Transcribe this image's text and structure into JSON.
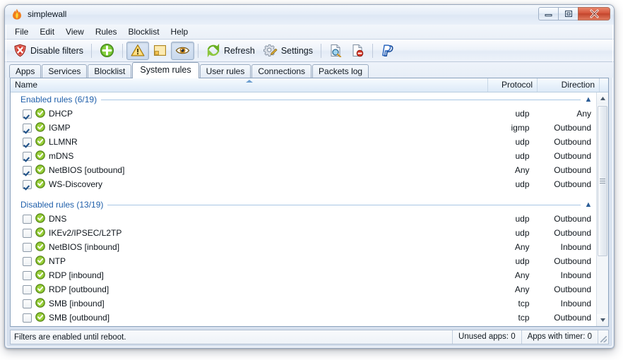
{
  "window": {
    "title": "simplewall",
    "icon": "flame-icon",
    "buttons": {
      "minimize": "Minimize",
      "maximize": "Maximize",
      "close": "Close"
    }
  },
  "menubar": {
    "items": [
      "File",
      "Edit",
      "View",
      "Rules",
      "Blocklist",
      "Help"
    ]
  },
  "toolbar": {
    "disable_filters_label": "Disable filters",
    "refresh_label": "Refresh",
    "settings_label": "Settings",
    "icons": [
      "shield-cross-icon",
      "add-circle-icon",
      "warning-triangle-icon",
      "notification-window-icon",
      "eye-icon",
      "refresh-icon",
      "settings-gear-icon",
      "log-search-icon",
      "log-clear-icon",
      "paypal-icon"
    ]
  },
  "tabs": {
    "items": [
      {
        "label": "Apps",
        "active": false
      },
      {
        "label": "Services",
        "active": false
      },
      {
        "label": "Blocklist",
        "active": false
      },
      {
        "label": "System rules",
        "active": true
      },
      {
        "label": "User rules",
        "active": false
      },
      {
        "label": "Connections",
        "active": false
      },
      {
        "label": "Packets log",
        "active": false
      }
    ]
  },
  "list": {
    "columns": [
      {
        "label": "Name",
        "sorted": "asc"
      },
      {
        "label": "Protocol",
        "sorted": ""
      },
      {
        "label": "Direction",
        "sorted": ""
      }
    ],
    "groups": [
      {
        "title": "Enabled rules (6/19)",
        "collapse_icon": "chevron-up-icon",
        "rows": [
          {
            "name": "DHCP",
            "checked": true,
            "protocol": "udp",
            "direction": "Any"
          },
          {
            "name": "IGMP",
            "checked": true,
            "protocol": "igmp",
            "direction": "Outbound"
          },
          {
            "name": "LLMNR",
            "checked": true,
            "protocol": "udp",
            "direction": "Outbound"
          },
          {
            "name": "mDNS",
            "checked": true,
            "protocol": "udp",
            "direction": "Outbound"
          },
          {
            "name": "NetBIOS [outbound]",
            "checked": true,
            "protocol": "Any",
            "direction": "Outbound"
          },
          {
            "name": "WS-Discovery",
            "checked": true,
            "protocol": "udp",
            "direction": "Outbound"
          }
        ]
      },
      {
        "title": "Disabled rules (13/19)",
        "collapse_icon": "chevron-up-icon",
        "rows": [
          {
            "name": "DNS",
            "checked": false,
            "protocol": "udp",
            "direction": "Outbound"
          },
          {
            "name": "IKEv2/IPSEC/L2TP",
            "checked": false,
            "protocol": "udp",
            "direction": "Outbound"
          },
          {
            "name": "NetBIOS [inbound]",
            "checked": false,
            "protocol": "Any",
            "direction": "Inbound"
          },
          {
            "name": "NTP",
            "checked": false,
            "protocol": "udp",
            "direction": "Outbound"
          },
          {
            "name": "RDP [inbound]",
            "checked": false,
            "protocol": "Any",
            "direction": "Inbound"
          },
          {
            "name": "RDP [outbound]",
            "checked": false,
            "protocol": "Any",
            "direction": "Outbound"
          },
          {
            "name": "SMB [inbound]",
            "checked": false,
            "protocol": "tcp",
            "direction": "Inbound"
          },
          {
            "name": "SMB [outbound]",
            "checked": false,
            "protocol": "tcp",
            "direction": "Outbound"
          }
        ]
      }
    ]
  },
  "statusbar": {
    "message": "Filters are enabled until reboot.",
    "unused_apps": "Unused apps: 0",
    "apps_with_timer": "Apps with timer: 0"
  },
  "colors": {
    "accent_blue": "#1f5faa",
    "rule_green": "#7fba29",
    "close_red": "#c3452c"
  }
}
